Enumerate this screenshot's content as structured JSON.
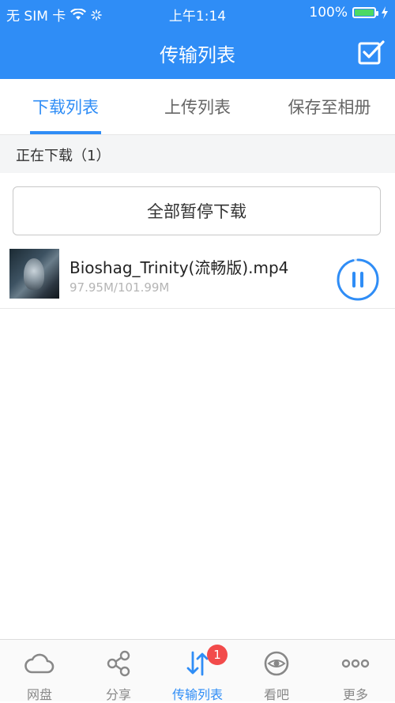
{
  "status_bar": {
    "carrier": "无 SIM 卡",
    "time": "上午1:14",
    "battery": "100%",
    "battery_level": 1.0
  },
  "nav": {
    "title": "传输列表"
  },
  "tabs": [
    {
      "label": "下载列表",
      "active": true
    },
    {
      "label": "上传列表",
      "active": false
    },
    {
      "label": "保存至相册",
      "active": false
    }
  ],
  "section": {
    "title": "正在下载（1）"
  },
  "actions": {
    "pause_all": "全部暂停下载"
  },
  "downloads": [
    {
      "name": "Bioshag_Trinity(流畅版).mp4",
      "size": "97.95M/101.99M",
      "progress": 0.96
    }
  ],
  "tabbar": [
    {
      "label": "网盘",
      "icon": "cloud-icon"
    },
    {
      "label": "分享",
      "icon": "share-icon"
    },
    {
      "label": "传输列表",
      "icon": "transfer-icon",
      "badge": "1",
      "active": true
    },
    {
      "label": "看吧",
      "icon": "eye-icon"
    },
    {
      "label": "更多",
      "icon": "more-icon"
    }
  ],
  "colors": {
    "accent": "#2F8DF6",
    "badge": "#F24B4B",
    "battery": "#4CD964"
  }
}
